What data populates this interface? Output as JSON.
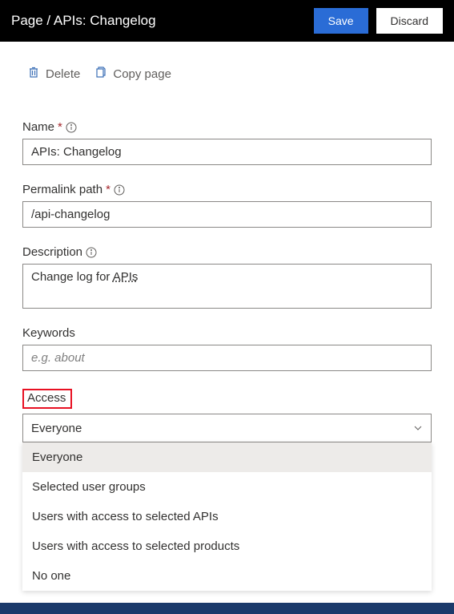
{
  "topbar": {
    "title": "Page / APIs: Changelog",
    "save": "Save",
    "discard": "Discard"
  },
  "actions": {
    "delete": "Delete",
    "copy": "Copy page"
  },
  "fields": {
    "name": {
      "label": "Name",
      "value": "APIs: Changelog"
    },
    "permalink": {
      "label": "Permalink path",
      "value": "/api-changelog"
    },
    "description": {
      "label": "Description",
      "prefix": "Change log for ",
      "underlined": "APIs"
    },
    "keywords": {
      "label": "Keywords",
      "placeholder": "e.g. about"
    },
    "access": {
      "label": "Access",
      "selected": "Everyone",
      "options": [
        "Everyone",
        "Selected user groups",
        "Users with access to selected APIs",
        "Users with access to selected products",
        "No one"
      ]
    }
  }
}
